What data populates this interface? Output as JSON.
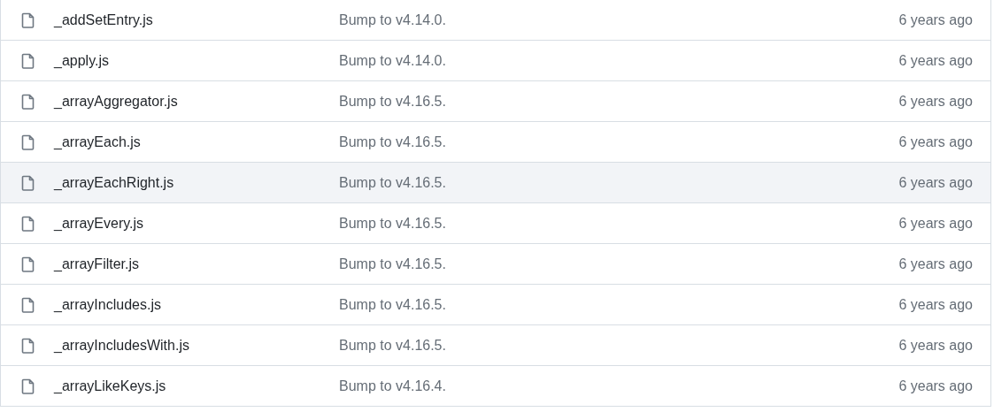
{
  "files": [
    {
      "name": "_addSetEntry.js",
      "message": "Bump to v4.14.0.",
      "time": "6 years ago",
      "selected": false
    },
    {
      "name": "_apply.js",
      "message": "Bump to v4.14.0.",
      "time": "6 years ago",
      "selected": false
    },
    {
      "name": "_arrayAggregator.js",
      "message": "Bump to v4.16.5.",
      "time": "6 years ago",
      "selected": false
    },
    {
      "name": "_arrayEach.js",
      "message": "Bump to v4.16.5.",
      "time": "6 years ago",
      "selected": false
    },
    {
      "name": "_arrayEachRight.js",
      "message": "Bump to v4.16.5.",
      "time": "6 years ago",
      "selected": true
    },
    {
      "name": "_arrayEvery.js",
      "message": "Bump to v4.16.5.",
      "time": "6 years ago",
      "selected": false
    },
    {
      "name": "_arrayFilter.js",
      "message": "Bump to v4.16.5.",
      "time": "6 years ago",
      "selected": false
    },
    {
      "name": "_arrayIncludes.js",
      "message": "Bump to v4.16.5.",
      "time": "6 years ago",
      "selected": false
    },
    {
      "name": "_arrayIncludesWith.js",
      "message": "Bump to v4.16.5.",
      "time": "6 years ago",
      "selected": false
    },
    {
      "name": "_arrayLikeKeys.js",
      "message": "Bump to v4.16.4.",
      "time": "6 years ago",
      "selected": false
    }
  ]
}
